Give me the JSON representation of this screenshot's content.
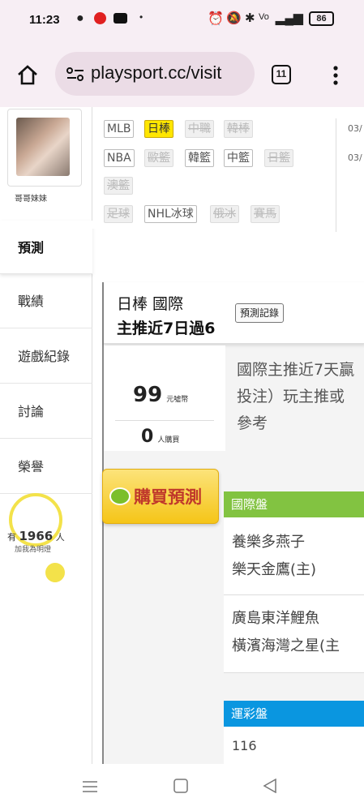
{
  "status": {
    "time": "11:23",
    "battery": "86"
  },
  "browser": {
    "url": "playsport.cc/visit",
    "tab_count": "11"
  },
  "profile": {
    "name": "哥哥妹妹"
  },
  "sidebar": {
    "items": [
      {
        "label": "預測"
      },
      {
        "label": "戰績"
      },
      {
        "label": "遊戲紀錄"
      },
      {
        "label": "討論"
      },
      {
        "label": "榮譽"
      }
    ],
    "fan_prefix": "有",
    "fan_count": "1966",
    "fan_suffix": "人",
    "fan_caption": "加我為明燈"
  },
  "leagues": {
    "row1": [
      "MLB",
      "日棒",
      "中職",
      "韓棒"
    ],
    "row2": [
      "NBA",
      "歐籃",
      "韓籃",
      "中籃",
      "日籃"
    ],
    "row3": [
      "澳籃"
    ],
    "row4": [
      "足球",
      "NHL冰球",
      "俄冰",
      "賽馬"
    ],
    "dates": [
      "03/",
      "03/"
    ]
  },
  "prediction": {
    "title": "日棒 國際",
    "subtitle": "主推近7日過6",
    "record_button": "預測記錄",
    "price": "99",
    "price_unit": "元噓幣",
    "buyers": "0",
    "buyers_unit": "人購買",
    "buy_button": "購買預測",
    "description_line1": "國際主推近7天贏",
    "description_line2": "投注）玩主推或",
    "description_line3": "參考"
  },
  "intl_section": {
    "header": "國際盤",
    "games": [
      {
        "away": "養樂多燕子",
        "home": "樂天金鷹(主)"
      },
      {
        "away": "廣島東洋鯉魚",
        "home": "橫濱海灣之星(主"
      }
    ]
  },
  "lottery_section": {
    "header": "運彩盤",
    "first_value": "116"
  },
  "colors": {
    "intl_header": "#82c341",
    "lottery_header": "#0a96e0",
    "tag_selected": "#ffe600",
    "buy_button": "#f5c518"
  }
}
